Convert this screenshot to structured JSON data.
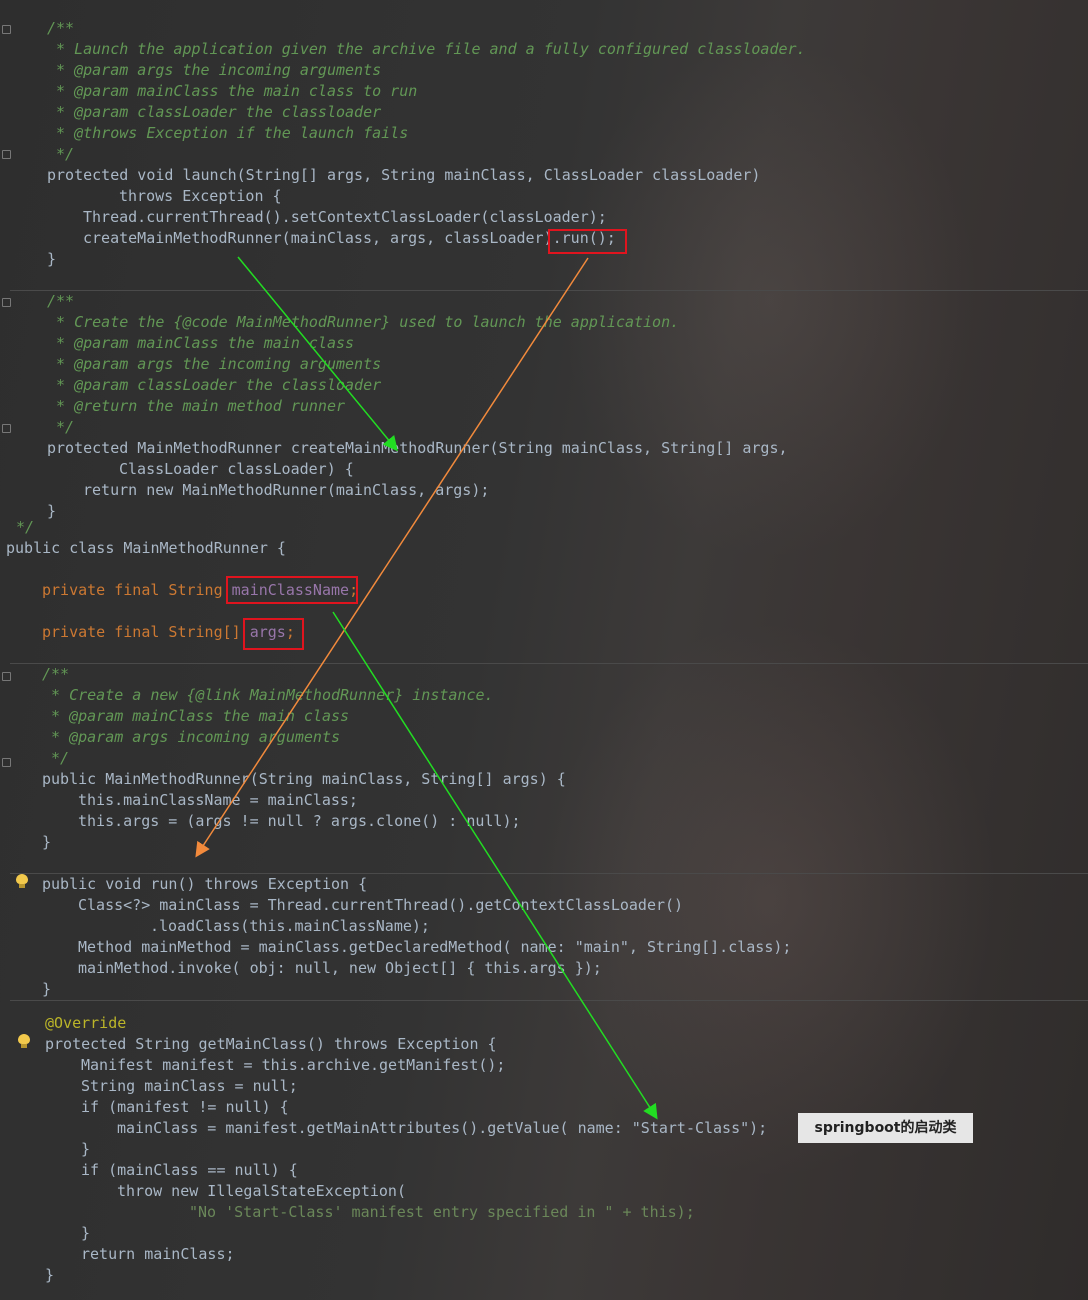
{
  "annotation": {
    "label": "springboot的启动类"
  },
  "launch_block": {
    "doc": [
      "/**",
      " * Launch the application given the archive file and a fully configured classloader.",
      " * @param args the incoming arguments",
      " * @param mainClass the main class to run",
      " * @param classLoader the classloader",
      " * @throws Exception if the launch fails",
      " */"
    ],
    "sig1": "protected void launch(String[] args, String mainClass, ClassLoader classLoader)",
    "sig2": "throws Exception {",
    "body1": "Thread.currentThread().setContextClassLoader(classLoader);",
    "body2a": "createMainMethodRunner(mainClass, args, classLoader)",
    "body2b": ".run();",
    "close": "}"
  },
  "create_block": {
    "doc": [
      "/**",
      " * Create the {@code MainMethodRunner} used to launch the application.",
      " * @param mainClass the main class",
      " * @param args the incoming arguments",
      " * @param classLoader the classloader",
      " * @return the main method runner",
      " */"
    ],
    "sig1": "protected MainMethodRunner createMainMethodRunner(String mainClass, String[] args,",
    "sig2": "ClassLoader classLoader) {",
    "body1": "return new MainMethodRunner(mainClass, args);",
    "close": "}",
    "trailer": "*/"
  },
  "runner_class": {
    "decl": "public class MainMethodRunner {",
    "field1_prefix": "private final String ",
    "field1_name": "mainClassName",
    "field1_semi": ";",
    "field2_prefix": "private final String[] ",
    "field2_name": "args",
    "field2_semi": ";",
    "doc": [
      "/**",
      " * Create a new {@link MainMethodRunner} instance.",
      " * @param mainClass the main class",
      " * @param args incoming arguments",
      " */"
    ],
    "ctor_sig": "public MainMethodRunner(String mainClass, String[] args) {",
    "ctor1": "this.mainClassName = mainClass;",
    "ctor2": "this.args = (args != null ? args.clone() : null);",
    "ctor_close": "}",
    "run_sig": "public void run() throws Exception {",
    "run1": "Class<?> mainClass = Thread.currentThread().getContextClassLoader()",
    "run2": ".loadClass(this.mainClassName);",
    "run3": "Method mainMethod = mainClass.getDeclaredMethod( name: \"main\", String[].class);",
    "run4": "mainMethod.invoke( obj: null, new Object[] { this.args });",
    "run_close": "}"
  },
  "getmain_block": {
    "annotation": "@Override",
    "sig": "protected String getMainClass() throws Exception {",
    "l1": "Manifest manifest = this.archive.getManifest();",
    "l2": "String mainClass = null;",
    "l3": "if (manifest != null) {",
    "l4": "mainClass = manifest.getMainAttributes().getValue( name: \"Start-Class\");",
    "l5": "}",
    "l6": "if (mainClass == null) {",
    "l7": "throw new IllegalStateException(",
    "l8": "\"No 'Start-Class' manifest entry specified in \" + this);",
    "l9": "}",
    "l10": "return mainClass;",
    "close": "}"
  },
  "colors": {
    "keyword": "#cc7832",
    "comment": "#629755",
    "method": "#ffc66d",
    "field": "#9876aa",
    "string": "#6a8759",
    "text": "#a9b7c6",
    "highlight_box": "#e0141e",
    "arrow_green": "#22dd22",
    "arrow_orange": "#f28a3c"
  },
  "icons": [
    "intention-bulb-icon",
    "fold-marker-icon"
  ]
}
